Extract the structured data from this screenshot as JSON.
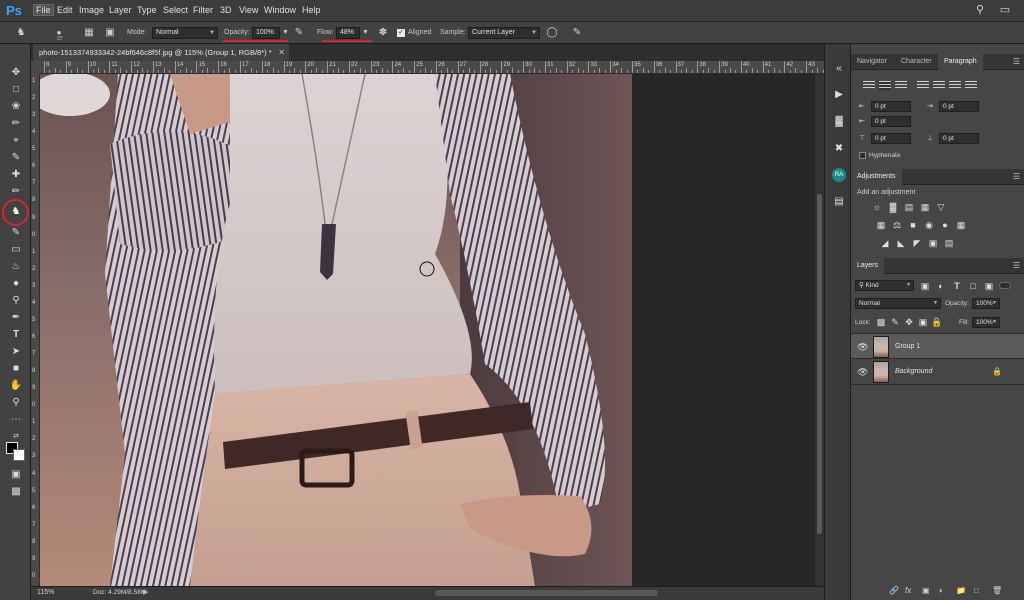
{
  "app": {
    "logo": "Ps"
  },
  "menu": [
    "File",
    "Edit",
    "Image",
    "Layer",
    "Type",
    "Select",
    "Filter",
    "3D",
    "View",
    "Window",
    "Help"
  ],
  "options": {
    "brush_size": "27",
    "mode_label": "Mode:",
    "mode_value": "Normal",
    "opacity_label": "Opacity:",
    "opacity_value": "100%",
    "flow_label": "Flow:",
    "flow_value": "48%",
    "aligned_label": "Aligned",
    "sample_label": "Sample:",
    "sample_value": "Current Layer"
  },
  "document": {
    "tab_title": "photo-1513374933342-24bf646c8f5f.jpg @ 115% (Group 1, RGB/8*) *",
    "zoom": "115%",
    "doc_info": "Doc: 4.29M/8.58M"
  },
  "ruler_top_numbers": [
    "8",
    "9",
    "10",
    "11",
    "12",
    "13",
    "14",
    "15",
    "16",
    "17",
    "18",
    "19",
    "20",
    "21",
    "22",
    "23",
    "24",
    "25",
    "26",
    "27",
    "28",
    "29",
    "30",
    "31",
    "32",
    "33",
    "34",
    "35",
    "36",
    "37",
    "38",
    "39",
    "40",
    "41",
    "42",
    "43"
  ],
  "ruler_left_numbers": [
    "1",
    "2",
    "3",
    "4",
    "5",
    "6",
    "7",
    "8",
    "9",
    "0",
    "1",
    "2",
    "3",
    "4",
    "5",
    "6",
    "7",
    "8",
    "9",
    "0",
    "1",
    "2",
    "3",
    "4",
    "5",
    "6",
    "7",
    "8",
    "9",
    "0"
  ],
  "panels": {
    "top_tabs": [
      "Navigator",
      "Character",
      "Paragraph"
    ],
    "indent_values": [
      "0 pt",
      "0 pt",
      "0 pt",
      "0 pt",
      "0 pt"
    ],
    "hyphenate": "Hyphenate",
    "adjustments_tab": "Adjustments",
    "adjustments_hint": "Add an adjustment",
    "layers_tab": "Layers",
    "kind_label": "Kind",
    "blend_mode": "Normal",
    "opacity_label": "Opacity:",
    "opacity_value": "100%",
    "lock_label": "Lock:",
    "fill_label": "Fill:",
    "fill_value": "100%",
    "layers": [
      {
        "name": "Group 1"
      },
      {
        "name": "Background"
      }
    ]
  },
  "colors": {
    "selection_highlight": "#d8242a",
    "accent": "#31a8ff"
  }
}
